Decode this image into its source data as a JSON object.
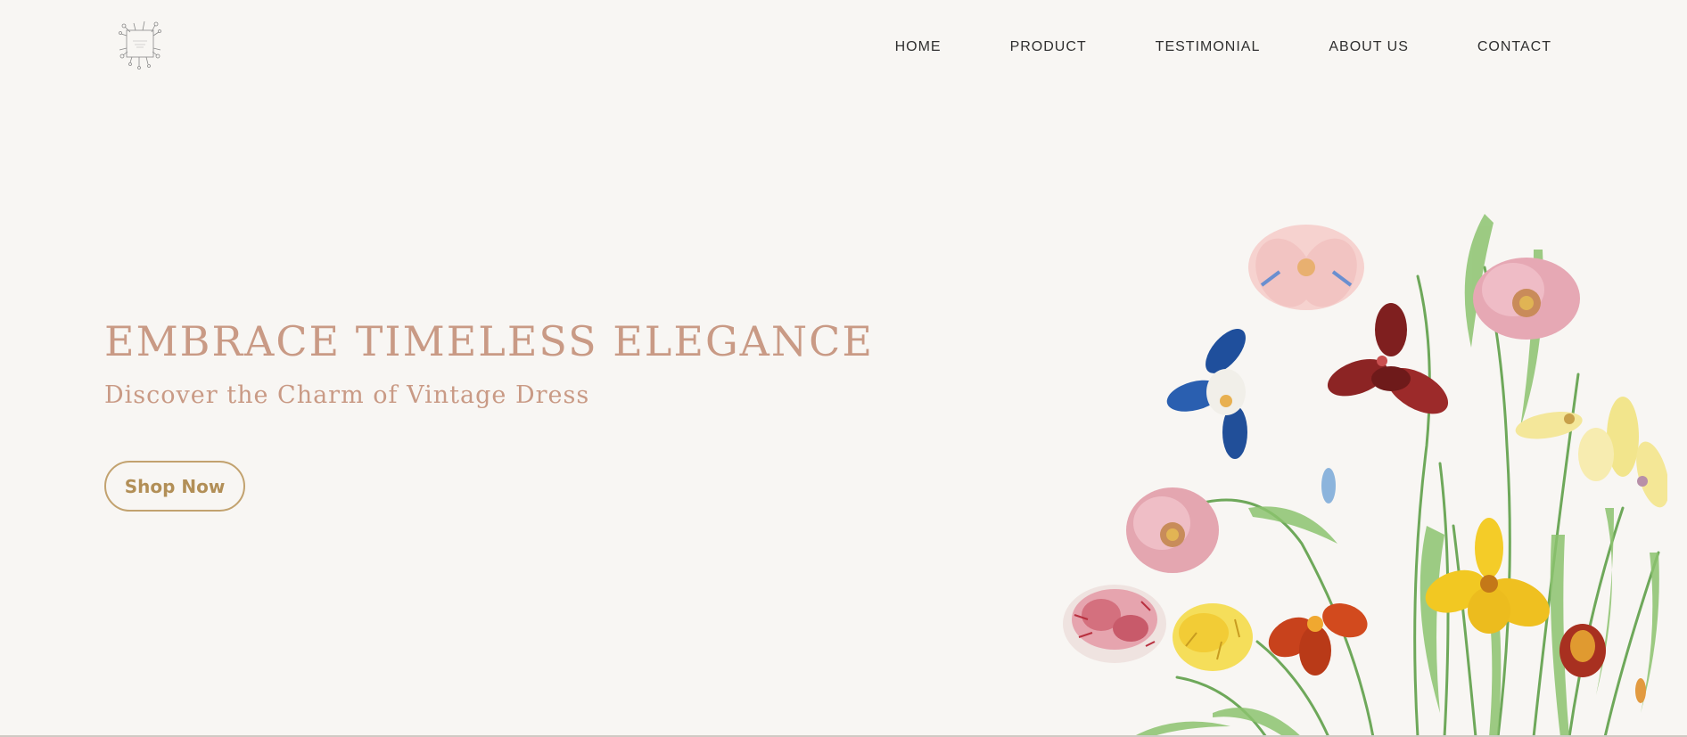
{
  "logo": {
    "icon": "floral-logo-icon"
  },
  "nav": {
    "items": [
      {
        "label": "HOME"
      },
      {
        "label": "PRODUCT"
      },
      {
        "label": "TESTIMONIAL"
      },
      {
        "label": "ABOUT US"
      },
      {
        "label": "CONTACT"
      }
    ]
  },
  "hero": {
    "title": "EMBRACE TIMELESS ELEGANCE",
    "subtitle": "Discover the Charm of Vintage Dress",
    "cta_label": "Shop Now"
  },
  "illustration": {
    "icon": "botanical-flowers-icon"
  },
  "colors": {
    "background": "#f8f6f3",
    "hero_text": "#c99a85",
    "cta_border": "#c2a26f",
    "nav_text": "#2f2f2f"
  }
}
